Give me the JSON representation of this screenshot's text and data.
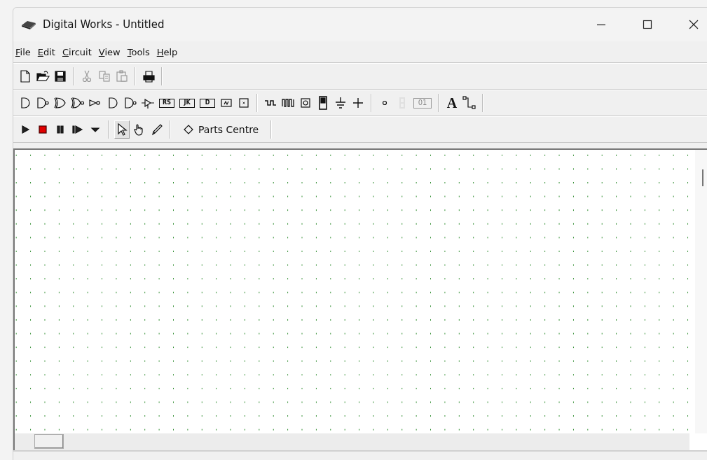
{
  "window": {
    "title": "Digital Works - Untitled"
  },
  "menu": [
    {
      "key": "F",
      "rest": "ile"
    },
    {
      "key": "E",
      "rest": "dit"
    },
    {
      "key": "C",
      "rest": "ircuit"
    },
    {
      "key": "V",
      "rest": "iew"
    },
    {
      "key": "T",
      "rest": "ools"
    },
    {
      "key": "H",
      "rest": "elp"
    }
  ],
  "file_toolbar": [
    {
      "kind": "new",
      "disabled": false
    },
    {
      "kind": "open",
      "disabled": false
    },
    {
      "kind": "save",
      "disabled": false
    },
    {
      "kind": "separator"
    },
    {
      "kind": "cut",
      "disabled": true
    },
    {
      "kind": "copy",
      "disabled": true
    },
    {
      "kind": "paste",
      "disabled": true
    },
    {
      "kind": "separator"
    },
    {
      "kind": "print",
      "disabled": false
    },
    {
      "kind": "separator"
    }
  ],
  "parts_toolbar": [
    {
      "kind": "and",
      "disabled": false
    },
    {
      "kind": "nand",
      "disabled": false
    },
    {
      "kind": "or",
      "disabled": false
    },
    {
      "kind": "nor",
      "disabled": false
    },
    {
      "kind": "not",
      "disabled": false
    },
    {
      "kind": "and",
      "disabled": false
    },
    {
      "kind": "nand",
      "disabled": false
    },
    {
      "kind": "tristate",
      "disabled": false
    },
    {
      "kind": "chip",
      "label": "RS",
      "disabled": false
    },
    {
      "kind": "chip",
      "label": "JK",
      "disabled": false
    },
    {
      "kind": "chip",
      "label": "D",
      "disabled": false
    },
    {
      "kind": "memory",
      "disabled": false
    },
    {
      "kind": "cross",
      "disabled": false
    },
    {
      "kind": "separator"
    },
    {
      "kind": "clock",
      "disabled": false
    },
    {
      "kind": "pulse",
      "disabled": false
    },
    {
      "kind": "push",
      "disabled": false
    },
    {
      "kind": "switch",
      "disabled": false
    },
    {
      "kind": "ground",
      "disabled": false
    },
    {
      "kind": "plus",
      "disabled": false
    },
    {
      "kind": "separator"
    },
    {
      "kind": "led",
      "disabled": false
    },
    {
      "kind": "segment",
      "disabled": true
    },
    {
      "kind": "chip",
      "label": "01",
      "disabled": true
    },
    {
      "kind": "separator"
    },
    {
      "kind": "letter",
      "label": "A",
      "disabled": false
    },
    {
      "kind": "wire",
      "disabled": false
    },
    {
      "kind": "separator"
    }
  ],
  "sim_toolbar": [
    {
      "kind": "run",
      "selected": false
    },
    {
      "kind": "stop",
      "selected": false
    },
    {
      "kind": "pause",
      "selected": false
    },
    {
      "kind": "step",
      "selected": false
    },
    {
      "kind": "dropdown",
      "selected": false
    },
    {
      "kind": "separator"
    },
    {
      "kind": "pointer",
      "selected": true
    },
    {
      "kind": "hand",
      "selected": false
    },
    {
      "kind": "pen",
      "selected": false
    },
    {
      "kind": "separator"
    },
    {
      "kind": "parts",
      "label": "Parts Centre",
      "selected": false
    },
    {
      "kind": "separator"
    }
  ]
}
